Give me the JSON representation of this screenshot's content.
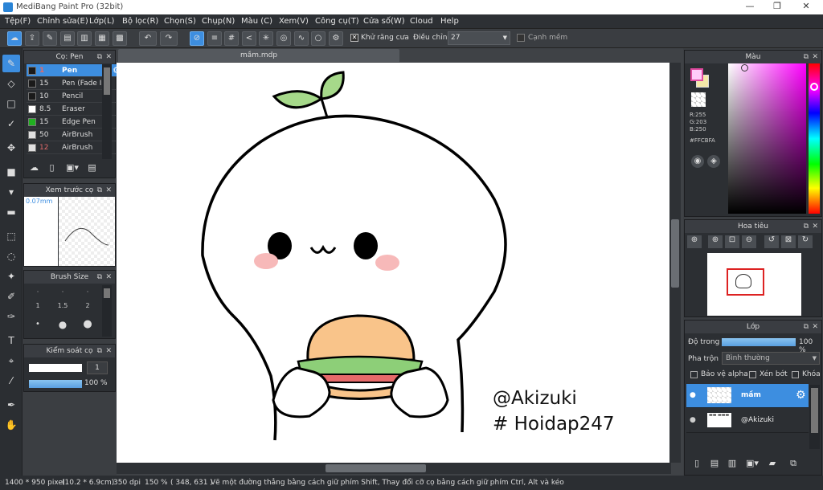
{
  "window": {
    "title": "MediBang Paint Pro (32bit)",
    "minimize": "—",
    "maximize": "❐",
    "close": "✕"
  },
  "menu": [
    "Tệp(F)",
    "Chỉnh sửa(E)",
    "Lớp(L)",
    "Bộ lọc(R)",
    "Chọn(S)",
    "Chụp(N)",
    "Màu (C)",
    "Xem(V)",
    "Công cụ(T)",
    "Cửa số(W)",
    "Cloud",
    "Help"
  ],
  "toolbar": {
    "antialias_label": "Khử răng cưa",
    "correction_label": "Điều chỉnh",
    "correction_value": "27",
    "soft_edge_label": "Cạnh mềm"
  },
  "brush_panel": {
    "title": "Cọ: Pen",
    "items": [
      {
        "size": "1",
        "name": "Pen",
        "color": "#1a1a1a"
      },
      {
        "size": "15",
        "name": "Pen (Fade In",
        "color": "#1a1a1a"
      },
      {
        "size": "10",
        "name": "Pencil",
        "color": "#1a1a1a"
      },
      {
        "size": "8.5",
        "name": "Eraser",
        "color": "#ffffff"
      },
      {
        "size": "15",
        "name": "Edge Pen",
        "color": "#20b020"
      },
      {
        "size": "50",
        "name": "AirBrush",
        "color": "#e0e0e0"
      },
      {
        "size": "12",
        "name": "AirBrush",
        "color": "#e0e0e0"
      }
    ]
  },
  "preview_panel": {
    "title": "Xem trước cọ",
    "size": "0.07mm"
  },
  "brushsize_panel": {
    "title": "Brush Size",
    "labels": [
      "1",
      "1.5",
      "2"
    ]
  },
  "brushctrl_panel": {
    "title": "Kiểm soát cọ",
    "size_value": "1",
    "opacity_value": "100 %"
  },
  "document": {
    "tab": "mầm.mdp",
    "text1": "@Akizuki",
    "text2": "# Hoidap247"
  },
  "color_panel": {
    "title": "Màu",
    "r": "R:255",
    "g": "G:203",
    "b": "B:250",
    "hex": "#FFCBFA",
    "fg": "#ffcbfa",
    "bg": "#f5e9a8"
  },
  "navigator": {
    "title": "Hoa tiêu"
  },
  "layer_panel": {
    "title": "Lớp",
    "opacity_label": "Độ trong",
    "opacity_value": "100 %",
    "blend_label": "Pha trộn",
    "blend_value": "Bình thường",
    "protect_alpha": "Bảo vệ alpha",
    "clipping": "Xén bớt",
    "lock": "Khóa",
    "layers": [
      {
        "name": "mầm"
      },
      {
        "name": "@Akizuki"
      }
    ]
  },
  "status": {
    "dims": "1400 * 950 pixel",
    "cm": "(10.2 * 6.9cm)",
    "dpi": "350 dpi",
    "zoom": "150 %",
    "coord": "( 348, 631 )",
    "hint": "Vẽ một đường thẳng bằng cách giữ phím Shift, Thay đổi cỡ cọ bằng cách giữ phím Ctrl, Alt và kéo"
  }
}
